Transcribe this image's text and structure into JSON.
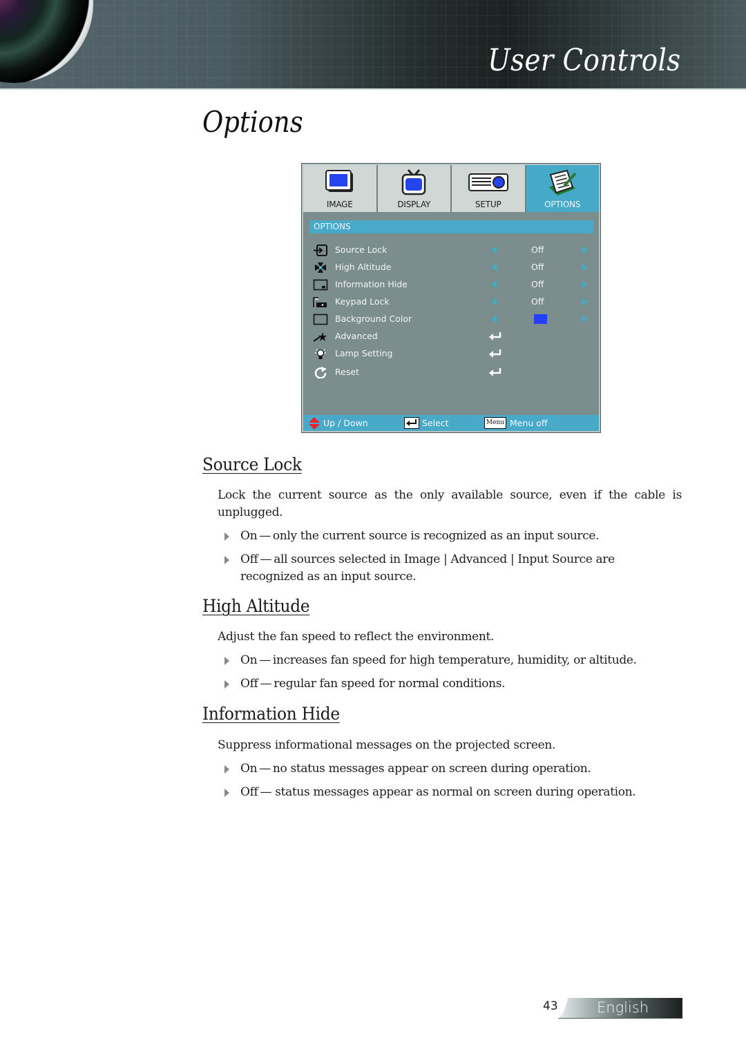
{
  "header": {
    "banner_title": "User Controls",
    "page_title": "Options"
  },
  "osd_menu": {
    "tabs": [
      {
        "label": "IMAGE",
        "icon": "monitor-icon",
        "active": false
      },
      {
        "label": "DISPLAY",
        "icon": "tv-icon",
        "active": false
      },
      {
        "label": "SETUP",
        "icon": "projector-icon",
        "active": false
      },
      {
        "label": "OPTIONS",
        "icon": "notepad-pen-icon",
        "active": true
      }
    ],
    "section_title": "OPTIONS",
    "rows": [
      {
        "label": "Source Lock",
        "icon": "source-lock-icon",
        "type": "toggle",
        "value": "Off"
      },
      {
        "label": "High Altitude",
        "icon": "fan-icon",
        "type": "toggle",
        "value": "Off"
      },
      {
        "label": "Information Hide",
        "icon": "info-hide-icon",
        "type": "toggle",
        "value": "Off"
      },
      {
        "label": "Keypad Lock",
        "icon": "keypad-lock-icon",
        "type": "toggle",
        "value": "Off"
      },
      {
        "label": "Background Color",
        "icon": "background-color-icon",
        "type": "color",
        "value": "#2440ff"
      },
      {
        "label": "Advanced",
        "icon": "advanced-icon",
        "type": "submenu"
      },
      {
        "label": "Lamp Setting",
        "icon": "lamp-icon",
        "type": "submenu"
      },
      {
        "label": "Reset",
        "icon": "reset-icon",
        "type": "submenu"
      }
    ],
    "footer": {
      "updown": "Up / Down",
      "select": "Select",
      "menu_key": "Menu",
      "menuoff": "Menu off"
    },
    "colors": {
      "accent": "#48a9c8",
      "panel": "#7b8d8c",
      "tab_inactive": "#d1d7d5"
    }
  },
  "sections": [
    {
      "heading": "Source Lock",
      "description": "Lock the current source as the only available source, even if the cable is unplugged.",
      "bullets": [
        "On — only the current source is recognized as an input source.",
        "Off — all sources selected in Image | Advanced | Input Source are recognized as an input source."
      ]
    },
    {
      "heading": "High Altitude",
      "description": "Adjust the fan speed to reflect the environment.",
      "bullets": [
        "On — increases fan speed for high temperature, humidity, or altitude.",
        "Off — regular fan speed for normal conditions."
      ]
    },
    {
      "heading": "Information Hide",
      "description": "Suppress informational messages on the projected screen.",
      "bullets": [
        "On — no status messages appear on screen during operation.",
        "Off —  status messages appear as normal on screen during operation."
      ]
    }
  ],
  "footer": {
    "page_number": "43",
    "language": "English"
  }
}
